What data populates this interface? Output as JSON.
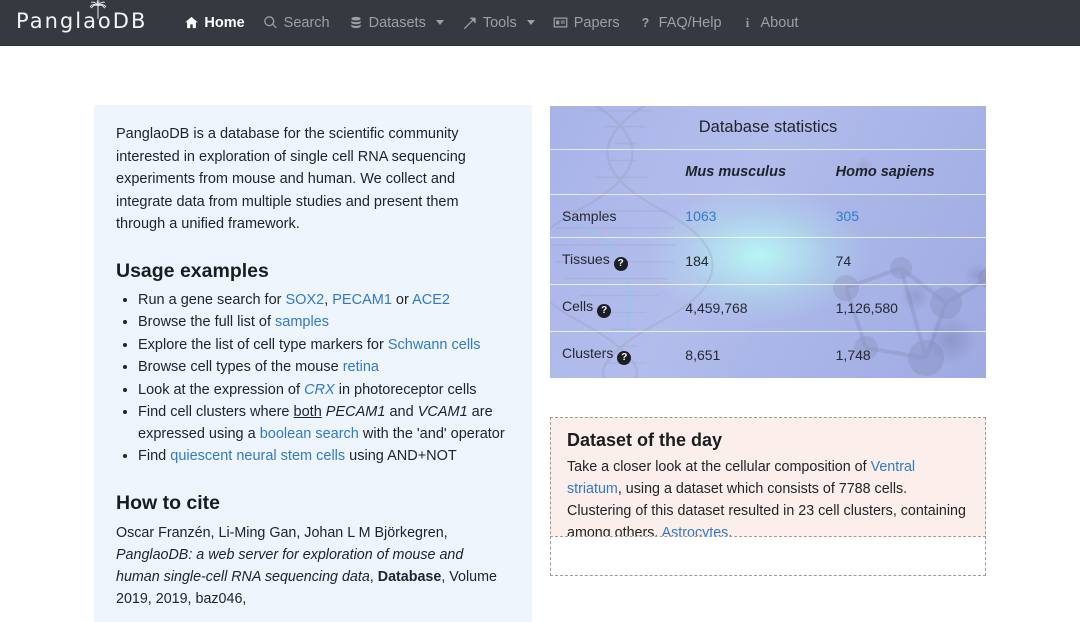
{
  "navbar": {
    "brand": "PanglaoDB",
    "brand_icon": "palm-tree-icon",
    "items": [
      {
        "label": "Home",
        "icon": "home-icon",
        "active": true,
        "caret": false
      },
      {
        "label": "Search",
        "icon": "search-icon",
        "active": false,
        "caret": false
      },
      {
        "label": "Datasets",
        "icon": "database-icon",
        "active": false,
        "caret": true
      },
      {
        "label": "Tools",
        "icon": "wrench-icon",
        "active": false,
        "caret": true
      },
      {
        "label": "Papers",
        "icon": "book-icon",
        "active": false,
        "caret": false
      },
      {
        "label": "FAQ/Help",
        "icon": "question-icon",
        "active": false,
        "caret": false
      },
      {
        "label": "About",
        "icon": "info-icon",
        "active": false,
        "caret": false
      }
    ]
  },
  "info": {
    "intro": "PanglaoDB is a database for the scientific community interested in exploration of single cell RNA sequencing experiments from mouse and human. We collect and integrate data from multiple studies and present them through a unified framework.",
    "usage_heading": "Usage examples",
    "usage": {
      "item1_pre": "Run a gene search for ",
      "item1_link1": "SOX2",
      "item1_mid1": ", ",
      "item1_link2": "PECAM1",
      "item1_mid2": " or ",
      "item1_link3": "ACE2",
      "item2_pre": "Browse the full list of ",
      "item2_link": "samples",
      "item3_pre": "Explore the list of cell type markers for ",
      "item3_link": "Schwann cells",
      "item4_pre": "Browse cell types of the mouse ",
      "item4_link": "retina",
      "item5_pre": "Look at the expression of ",
      "item5_gene": "CRX",
      "item5_post": " in photoreceptor cells",
      "item6_pre": "Find cell clusters where ",
      "item6_und": "both",
      "item6_mid1": " ",
      "item6_gene1": "PECAM1",
      "item6_mid2": " and ",
      "item6_gene2": "VCAM1",
      "item6_mid3": " are expressed using a ",
      "item6_link": "boolean search",
      "item6_post": " with the 'and' operator",
      "item7_pre": "Find ",
      "item7_link": "quiescent neural stem cells",
      "item7_post": " using AND+NOT"
    },
    "cite_heading": "How to cite",
    "cite": {
      "authors": "Oscar Franzén, Li-Ming Gan, Johan L M Björkegren, ",
      "title": "PanglaoDB: a web server for exploration of mouse and human single-cell RNA sequencing data",
      "comma": ", ",
      "journal": "Database",
      "rest": ", Volume 2019, 2019, baz046,"
    }
  },
  "stats": {
    "title": "Database statistics",
    "columns": [
      "",
      "Mus musculus",
      "Homo sapiens"
    ],
    "rows": [
      {
        "label": "Samples",
        "help": false,
        "mouse": "1063",
        "human": "305",
        "link": true
      },
      {
        "label": "Tissues",
        "help": true,
        "mouse": "184",
        "human": "74",
        "link": false
      },
      {
        "label": "Cells",
        "help": true,
        "mouse": "4,459,768",
        "human": "1,126,580",
        "link": false
      },
      {
        "label": "Clusters",
        "help": true,
        "mouse": "8,651",
        "human": "1,748",
        "link": false
      }
    ],
    "help_glyph": "?"
  },
  "dataset_of_the_day": {
    "heading": "Dataset of the day",
    "text_pre": "Take a closer look at the cellular composition of ",
    "link_tissue": "Ventral striatum",
    "text_mid": ", using a dataset which consists of 7788 cells. Clustering of this dataset resulted in 23 cell clusters, containing among others, ",
    "link_celltype": "Astrocytes",
    "text_post": "."
  },
  "colors": {
    "navbar_bg": "#343a40",
    "link_blue": "#2f7bc9",
    "info_panel_bg": "#eef5fc",
    "stats_bg": "#aeb8ea",
    "dotd_bg": "#fbeeeb"
  }
}
